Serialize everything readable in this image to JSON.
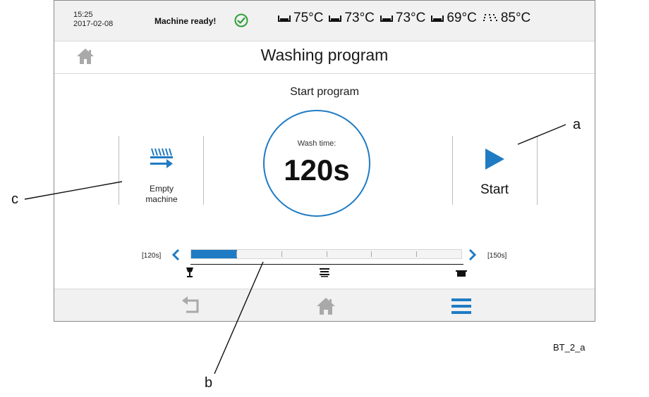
{
  "status_bar": {
    "time": "15:25",
    "date": "2017-02-08",
    "message": "Machine ready!",
    "temperatures": [
      {
        "icon": "tank-icon",
        "value": "75°C"
      },
      {
        "icon": "tank-icon",
        "value": "73°C"
      },
      {
        "icon": "tank-icon",
        "value": "73°C"
      },
      {
        "icon": "tank-icon",
        "value": "69°C"
      },
      {
        "icon": "rinse-spray-icon",
        "value": "85°C"
      }
    ]
  },
  "header": {
    "title": "Washing program"
  },
  "main": {
    "subtitle": "Start program",
    "empty_machine_line1": "Empty",
    "empty_machine_line2": "machine",
    "wash_time_label": "Wash time:",
    "wash_time_value": "120s",
    "start_label": "Start"
  },
  "slider": {
    "min_label": "[120s]",
    "max_label": "[150s]",
    "value_fraction": 0.17,
    "segments": 6,
    "program_icons": [
      "glass-icon",
      "plates-icon",
      "pot-icon"
    ]
  },
  "bottom_nav": [
    "back-icon",
    "home-icon",
    "menu-icon"
  ],
  "callouts": {
    "a": "a",
    "b": "b",
    "c": "c"
  },
  "figure_id": "BT_2_a",
  "colors": {
    "accent": "#1f7bc3",
    "ok_green": "#2e9e3a",
    "icon_gray": "#a9a9a9"
  }
}
